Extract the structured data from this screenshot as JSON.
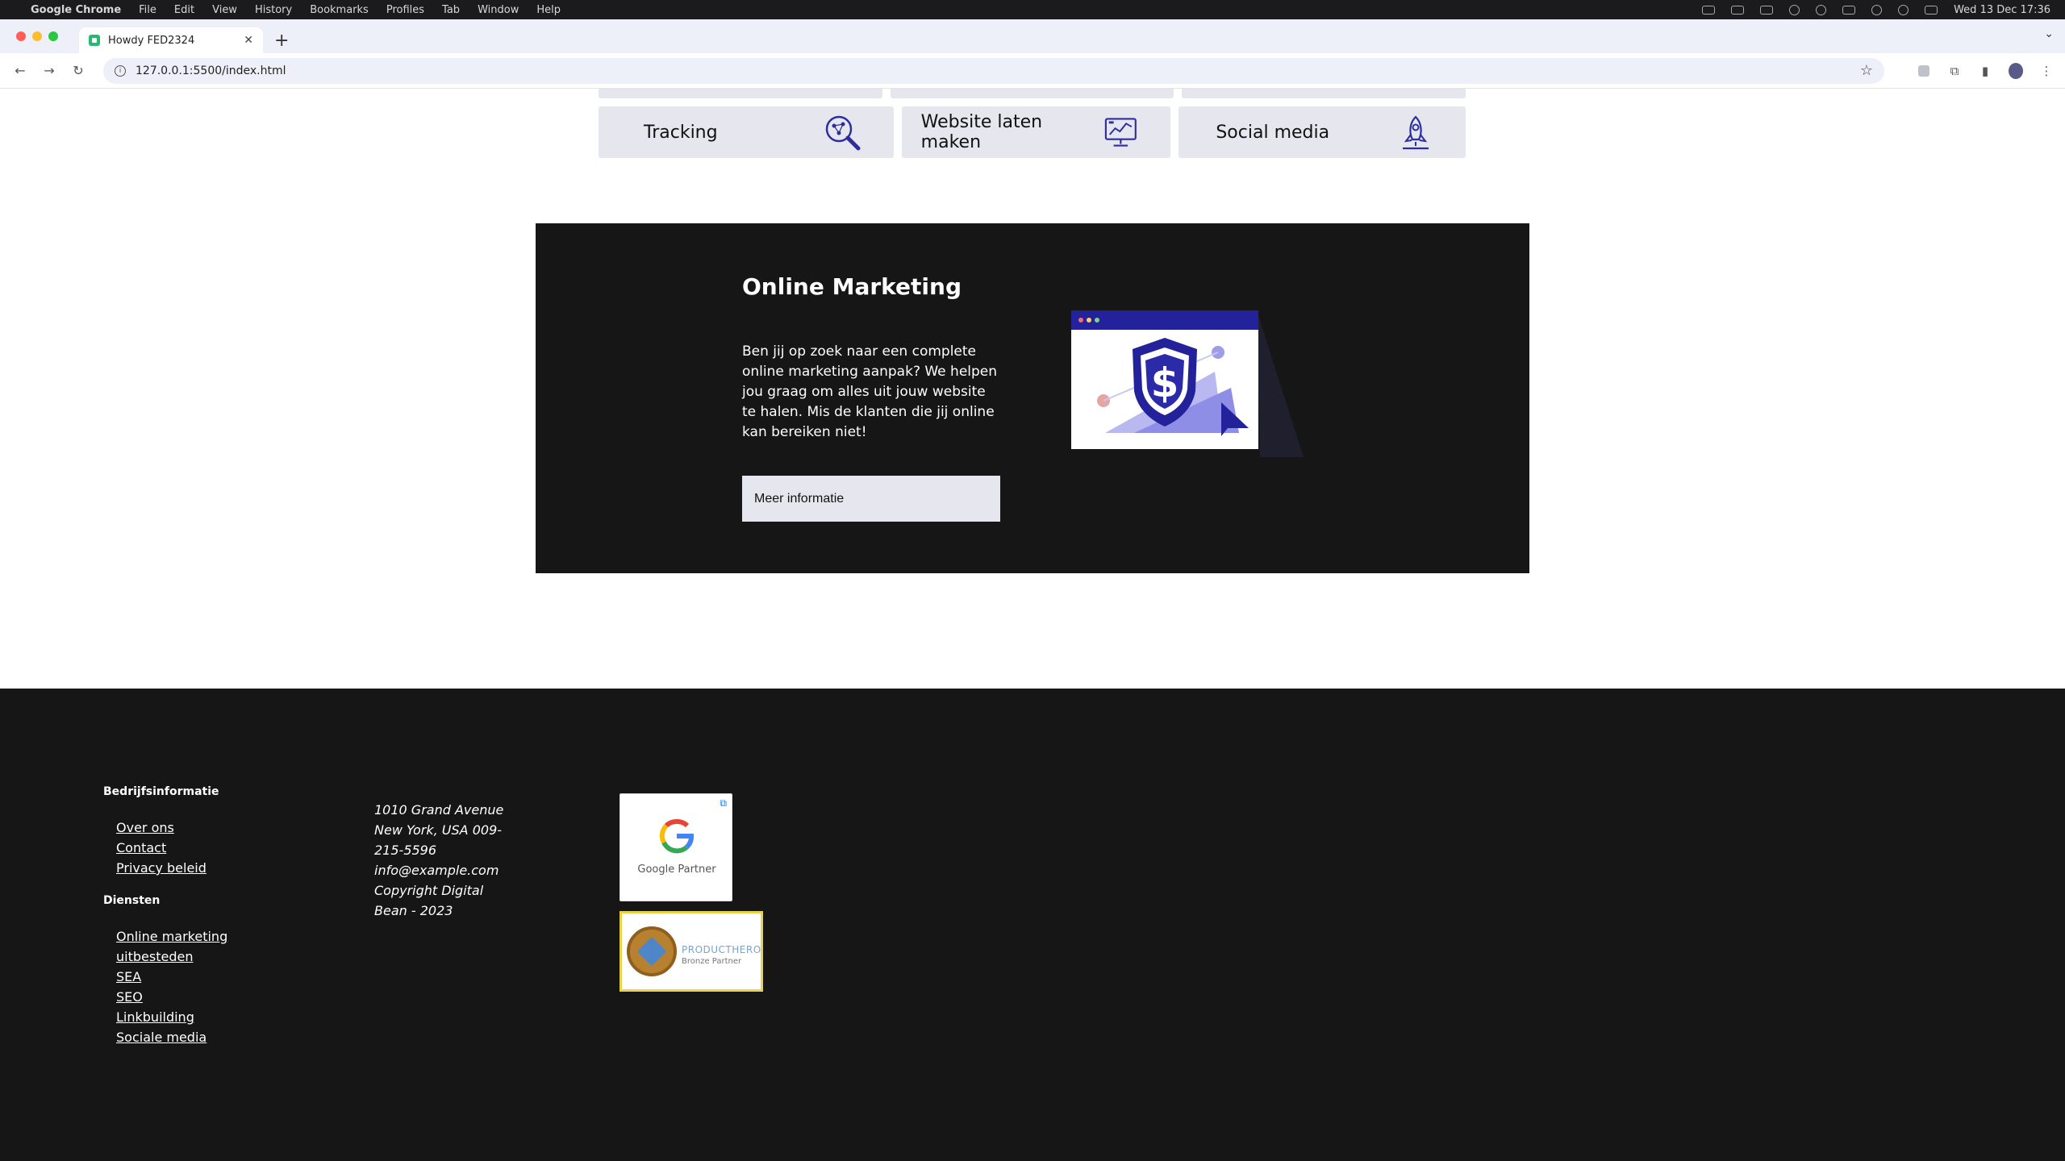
{
  "menubar": {
    "app_name": "Google Chrome",
    "items": [
      "File",
      "Edit",
      "View",
      "History",
      "Bookmarks",
      "Profiles",
      "Tab",
      "Window",
      "Help"
    ],
    "clock": "Wed 13 Dec  17:36"
  },
  "browser": {
    "tab_title": "Howdy FED2324",
    "url": "127.0.0.1:5500/index.html"
  },
  "services": {
    "cards": [
      {
        "label": "Tracking",
        "icon": "magnifier-icon"
      },
      {
        "label": "Website laten maken",
        "icon": "monitor-chart-icon"
      },
      {
        "label": "Social media",
        "icon": "rocket-icon"
      }
    ]
  },
  "promo": {
    "title": "Online Marketing",
    "text": "Ben jij op zoek naar een complete online marketing aanpak? We helpen jou graag om alles uit jouw website te halen. Mis de klanten die jij online kan bereiken niet!",
    "button_label": "Meer informatie",
    "illustration_glyph": "$"
  },
  "footer": {
    "company_heading": "Bedrijfsinformatie",
    "company_links": [
      "Over ons",
      "Contact",
      "Privacy beleid"
    ],
    "services_heading": "Diensten",
    "services_links": [
      "Online marketing uitbesteden",
      "SEA",
      "SEO",
      "Linkbuilding",
      "Sociale media"
    ],
    "address": "1010 Grand Avenue New York, USA 009-215-5596 info@example.com Copyright Digital Bean - 2023",
    "google_badge": {
      "logo_letter": "G",
      "label": "Google Partner"
    },
    "producthero_badge": {
      "name": "PRODUCTHERO",
      "tier": "Bronze Partner"
    }
  },
  "colors": {
    "dark_section": "#161616",
    "card_bg": "#e6e6ee",
    "icon_stroke": "#2d2d9f"
  }
}
